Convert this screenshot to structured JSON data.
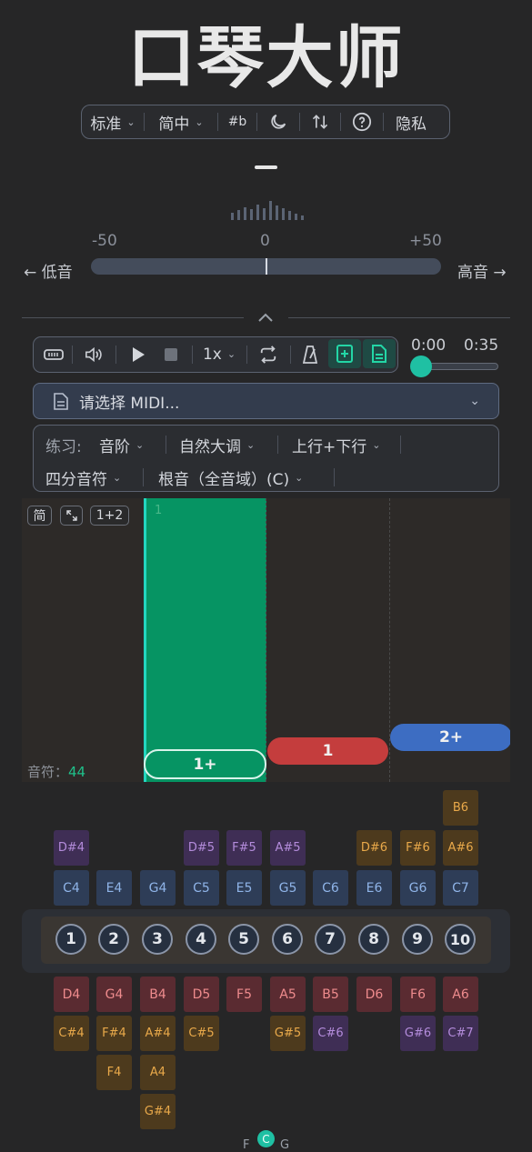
{
  "app": {
    "title": "口琴大师"
  },
  "toolbar": {
    "tuning": "标准",
    "language": "简中",
    "accidental": "#b",
    "privacy": "隐私"
  },
  "tuner": {
    "min_label": "-50",
    "mid_label": "0",
    "max_label": "+50",
    "low_label": "← 低音",
    "high_label": "高音 →",
    "deviation_cents": 0
  },
  "player": {
    "speed": "1x",
    "time_current": "0:00",
    "time_total": "0:35",
    "progress": 0.0
  },
  "midi": {
    "placeholder": "请选择 MIDI..."
  },
  "practice": {
    "label": "练习:",
    "mode": "音阶",
    "scale": "自然大调",
    "direction": "上行+下行",
    "rhythm": "四分音符",
    "root": "根音（全音域）(C)"
  },
  "roll": {
    "btn_simple": "简",
    "btn_both": "1+2",
    "measure": "1",
    "notes_label": "音符：",
    "notes_count": "44",
    "bars": [
      {
        "label": "1+",
        "color": "#0a9a6a"
      },
      {
        "label": "1",
        "color": "#c43d3d"
      },
      {
        "label": "2+",
        "color": "#3d6dc2"
      }
    ]
  },
  "harmonica": {
    "holes": [
      "1",
      "2",
      "3",
      "4",
      "5",
      "6",
      "7",
      "8",
      "9",
      "10"
    ],
    "blow_top": [
      "",
      "",
      "",
      "",
      "",
      "",
      "",
      "",
      "",
      "B6"
    ],
    "blow_bend": [
      "D#4",
      "",
      "",
      "D#5",
      "F#5",
      "A#5",
      "",
      "D#6",
      "F#6",
      "A#6"
    ],
    "blow": [
      "C4",
      "E4",
      "G4",
      "C5",
      "E5",
      "G5",
      "C6",
      "E6",
      "G6",
      "C7"
    ],
    "draw": [
      "D4",
      "G4",
      "B4",
      "D5",
      "F5",
      "A5",
      "B5",
      "D6",
      "F6",
      "A6"
    ],
    "draw_bend1": [
      "C#4",
      "F#4",
      "A#4",
      "C#5",
      "",
      "G#5",
      "C#6",
      "",
      "G#6",
      "C#7"
    ],
    "draw_bend2": [
      "",
      "F4",
      "A4",
      "",
      "",
      "",
      "",
      "",
      "",
      ""
    ],
    "draw_bend3": [
      "",
      "",
      "G#4",
      "",
      "",
      "",
      "",
      "",
      "",
      ""
    ]
  },
  "key_selector": {
    "prev": "F",
    "current": "C",
    "next": "G"
  },
  "colors": {
    "accent": "#1fc0a3",
    "blow": "#2e3d57",
    "draw": "#5a2b31"
  }
}
